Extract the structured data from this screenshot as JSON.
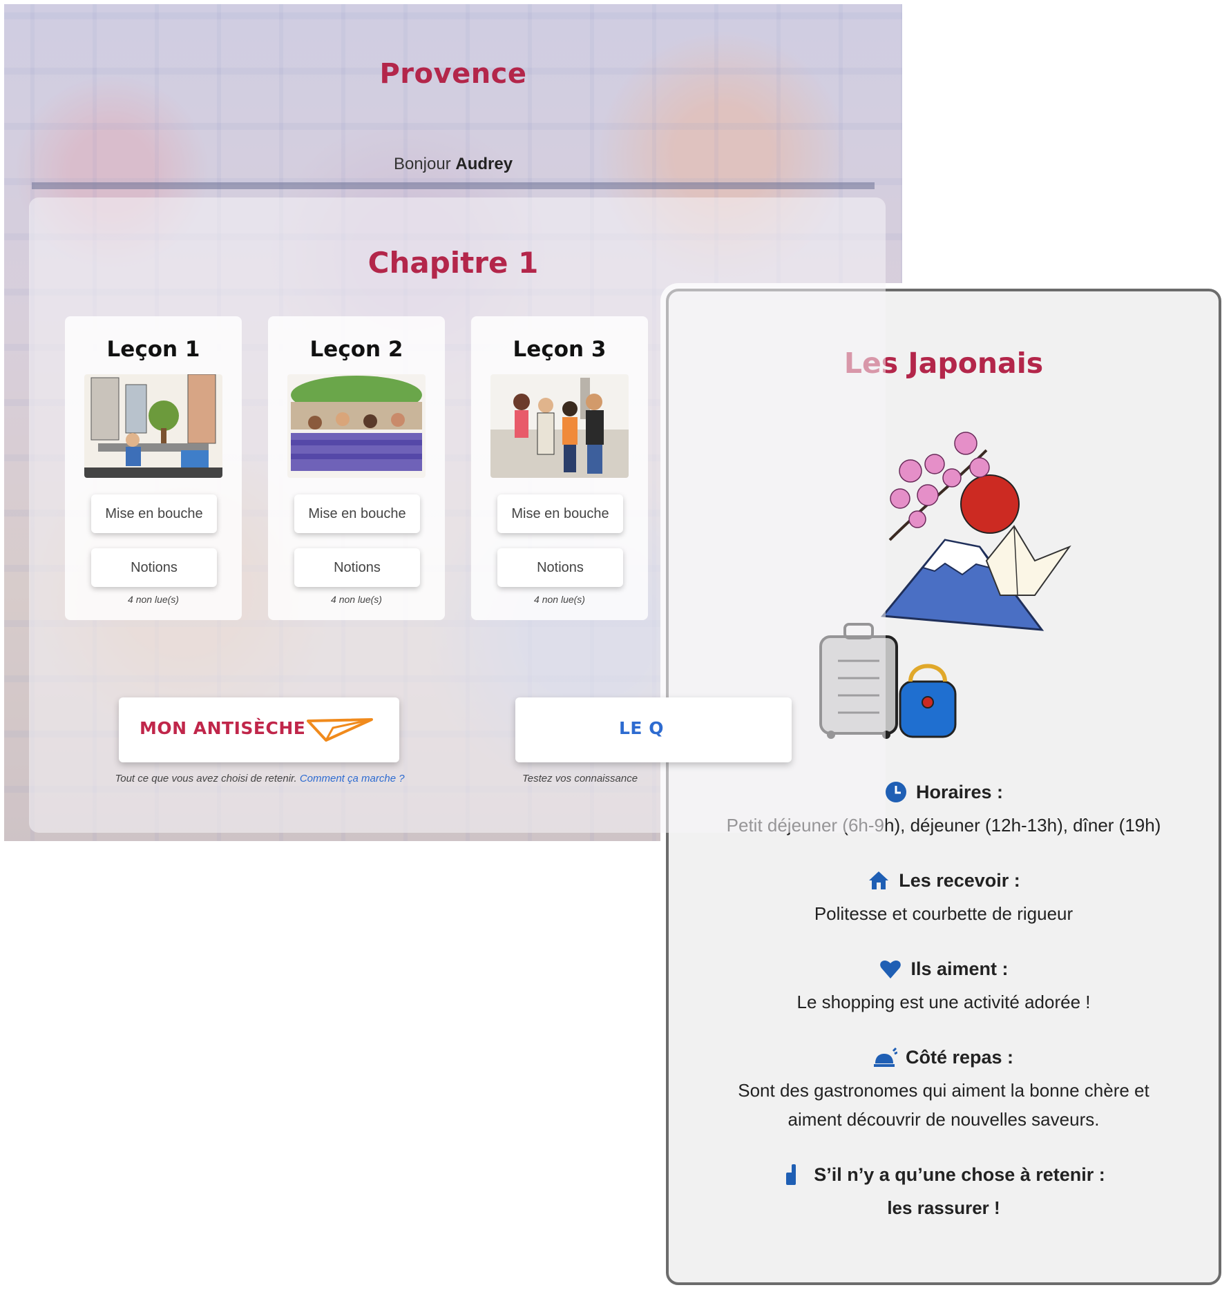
{
  "app": {
    "title": "Provence",
    "greeting_prefix": "Bonjour",
    "user_name": "Audrey",
    "chapter_title": "Chapitre 1",
    "lessons": [
      {
        "title": "Leçon 1",
        "primary_button": "Mise en bouche",
        "secondary_button": "Notions",
        "unread": "4 non lue(s)"
      },
      {
        "title": "Leçon 2",
        "primary_button": "Mise en bouche",
        "secondary_button": "Notions",
        "unread": "4 non lue(s)"
      },
      {
        "title": "Leçon 3",
        "primary_button": "Mise en bouche",
        "secondary_button": "Notions",
        "unread": "4 non lue(s)"
      }
    ],
    "cheatsheet": {
      "label": "MON ANTISÈCHE",
      "caption": "Tout ce que vous avez choisi de retenir.",
      "link": "Comment ça marche ?"
    },
    "quiz": {
      "label": "LE Q",
      "caption": "Testez vos connaissance"
    }
  },
  "card": {
    "title": "Les Japonais",
    "sections": [
      {
        "icon": "clock-icon",
        "heading": "Horaires :",
        "body": "Petit déjeuner (6h-9h), déjeuner (12h-13h), dîner (19h)"
      },
      {
        "icon": "home-icon",
        "heading": "Les recevoir :",
        "body": "Politesse et courbette de rigueur"
      },
      {
        "icon": "heart-icon",
        "heading": "Ils aiment :",
        "body": "Le shopping est une activité adorée !"
      },
      {
        "icon": "dish-icon",
        "heading": "Côté repas :",
        "body_line1": "Sont des gastronomes qui aiment la bonne chère et",
        "body_line2": "aiment découvrir de nouvelles saveurs."
      },
      {
        "icon": "thumbs-up-icon",
        "heading": "S’il n’y a qu’une chose à retenir :",
        "body": "les rassurer !"
      }
    ]
  },
  "colors": {
    "accent": "#b3264a",
    "icon_blue": "#1f5fb4",
    "card_bg": "#f1f1f1"
  }
}
